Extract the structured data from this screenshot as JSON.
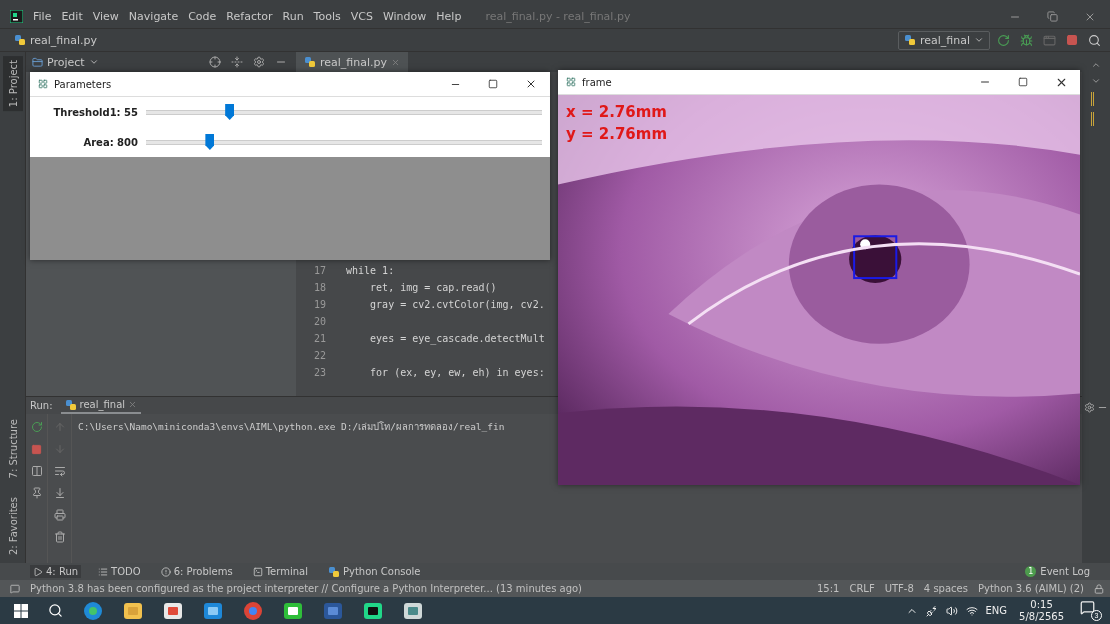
{
  "ide": {
    "menu": [
      "File",
      "Edit",
      "View",
      "Navigate",
      "Code",
      "Refactor",
      "Run",
      "Tools",
      "VCS",
      "Window",
      "Help"
    ],
    "window_title": "real_final.py - real_final.py",
    "breadcrumb": "real_final.py",
    "run_config": "real_final",
    "left_tools_top": [
      {
        "label": "1: Project",
        "selected": true
      }
    ],
    "left_tools_bottom": [
      {
        "label": "7: Structure",
        "selected": false
      },
      {
        "label": "2: Favorites",
        "selected": false
      }
    ],
    "project_panel": {
      "title": "Project"
    },
    "editor_tabs": [
      {
        "label": "real_final.py",
        "selected": true
      }
    ],
    "code_lines": [
      {
        "number": "17",
        "code": "while 1:"
      },
      {
        "number": "18",
        "code": "    ret, img = cap.read()"
      },
      {
        "number": "19",
        "code": "    gray = cv2.cvtColor(img, cv2."
      },
      {
        "number": "20"
      },
      {
        "number": "21",
        "code": "    eyes = eye_cascade.detectMult"
      },
      {
        "number": "22"
      },
      {
        "number": "23",
        "code": "    for (ex, ey, ew, eh) in eyes:"
      }
    ],
    "run_panel": {
      "label": "Run:",
      "tab": "real_final",
      "output": "C:\\Users\\Namo\\miniconda3\\envs\\AIML\\python.exe D:/เล่มปโท/ผลการทดลอง/real_fin"
    },
    "bottom_tools": [
      {
        "kind": "run",
        "label": "4: Run",
        "selected": true
      },
      {
        "kind": "todo",
        "label": "TODO",
        "selected": false
      },
      {
        "kind": "problems",
        "label": "6: Problems",
        "selected": false
      },
      {
        "kind": "terminal",
        "label": "Terminal",
        "selected": false
      },
      {
        "kind": "console",
        "label": "Python Console",
        "selected": false
      }
    ],
    "event_log": {
      "count": "1",
      "label": "Event Log"
    },
    "status_message": "Python 3.8 has been configured as the project interpreter // Configure a Python Interpreter... (13 minutes ago)",
    "status_items": [
      "15:1",
      "CRLF",
      "UTF-8",
      "4 spaces",
      "Python 3.6 (AIML) (2)"
    ]
  },
  "parameters_window": {
    "title": "Parameters",
    "sliders": [
      {
        "label": "Threshold1: 55",
        "level": 0.21
      },
      {
        "label": "Area: 800",
        "level": 0.16
      }
    ]
  },
  "frame_window": {
    "title": "frame",
    "overlay_lines": [
      "x = 2.76mm",
      "y = 2.76mm"
    ]
  },
  "tray": {
    "language": "ENG",
    "time": "0:15",
    "date": "5/8/2565",
    "notifications": "3"
  }
}
